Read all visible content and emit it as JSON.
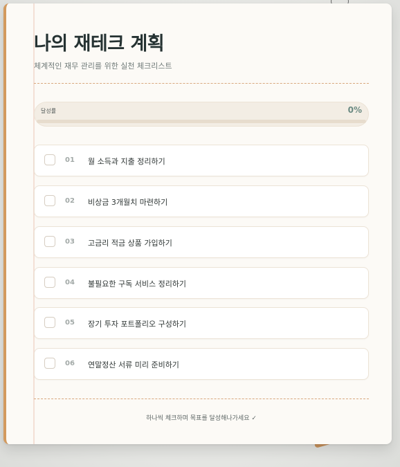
{
  "header": {
    "title": "나의 재테크 계획",
    "subtitle": "체계적인 재무 관리를 위한 실천 체크리스트"
  },
  "progress": {
    "label": "달성률",
    "value_text": "0%",
    "fraction": 0
  },
  "tasks": [
    {
      "num": "01",
      "text": "월 소득과 지출 정리하기",
      "checked": false
    },
    {
      "num": "02",
      "text": "비상금 3개월치 마련하기",
      "checked": false
    },
    {
      "num": "03",
      "text": "고금리 적금 상품 가입하기",
      "checked": false
    },
    {
      "num": "04",
      "text": "불필요한 구독 서비스 정리하기",
      "checked": false
    },
    {
      "num": "05",
      "text": "장기 투자 포트폴리오 구성하기",
      "checked": false
    },
    {
      "num": "06",
      "text": "연말정산 서류 미리 준비하기",
      "checked": false
    }
  ],
  "footer": {
    "text": "하나씩 체크하며 목표를 달성해나가세요 ✓"
  },
  "colors": {
    "accent": "#6b8a82",
    "margin_stripe": "#d39a5e",
    "title": "#253232"
  }
}
